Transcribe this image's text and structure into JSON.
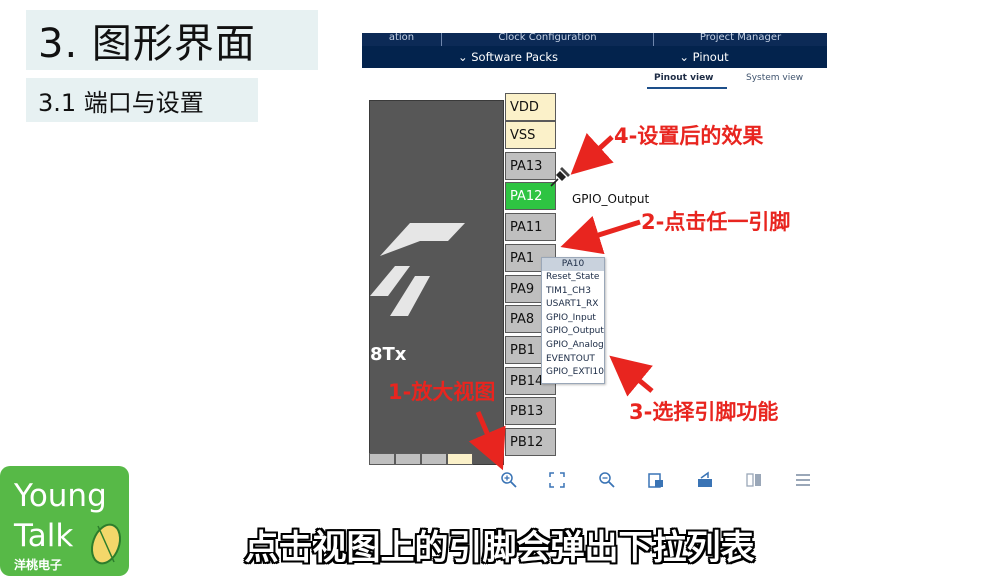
{
  "slide": {
    "title": "3. 图形界面",
    "section": "3.1 端口与设置",
    "corner_mark": "?????"
  },
  "app": {
    "top_tabs": [
      "ation",
      "Clock Configuration",
      "Project Manager"
    ],
    "sub_tabs": [
      "Software Packs",
      "Pinout"
    ],
    "view_tabs": {
      "active": "Pinout view",
      "inactive": "System view"
    },
    "chip_part": "8Tx",
    "pins": [
      {
        "name": "VDD",
        "type": "power"
      },
      {
        "name": "VSS",
        "type": "power"
      },
      {
        "name": "PA13",
        "type": "io"
      },
      {
        "name": "PA12",
        "type": "gpio"
      },
      {
        "name": "PA11",
        "type": "io"
      },
      {
        "name": "PA10",
        "type": "io"
      },
      {
        "name": "PA9",
        "type": "io"
      },
      {
        "name": "PA8",
        "type": "io"
      },
      {
        "name": "PB15",
        "type": "io"
      },
      {
        "name": "PB14",
        "type": "io"
      },
      {
        "name": "PB13",
        "type": "io"
      },
      {
        "name": "PB12",
        "type": "io"
      }
    ],
    "pin_labels_visible": [
      "VDD",
      "VSS",
      "PA13",
      "PA12",
      "PA11",
      "PA1",
      "PA9",
      "PA8",
      "PB1",
      "PB14",
      "PB13",
      "PB12"
    ],
    "pin_assignment_label": "GPIO_Output",
    "dropdown": {
      "header": "PA10",
      "items": [
        "Reset_State",
        "TIM1_CH3",
        "USART1_RX",
        "GPIO_Input",
        "GPIO_Output",
        "GPIO_Analog",
        "EVENTOUT",
        "GPIO_EXTI10"
      ]
    },
    "toolbar_icons": [
      "zoom-in-icon",
      "fit-screen-icon",
      "zoom-out-icon",
      "export-icon",
      "rotate-icon",
      "split-view-icon",
      "menu-icon"
    ]
  },
  "annotations": {
    "step1": "1-放大视图",
    "step2": "2-点击任一引脚",
    "step3": "3-选择引脚功能",
    "step4": "4-设置后的效果"
  },
  "logo": {
    "line1": "Young",
    "line2": "Talk",
    "line3": "洋桃电子"
  },
  "caption": "点击视图上的引脚会弹出下拉列表",
  "colors": {
    "accent_red": "#e8251f",
    "header_navy": "#03234d",
    "gpio_green": "#2ec442",
    "logo_green": "#57b947"
  }
}
